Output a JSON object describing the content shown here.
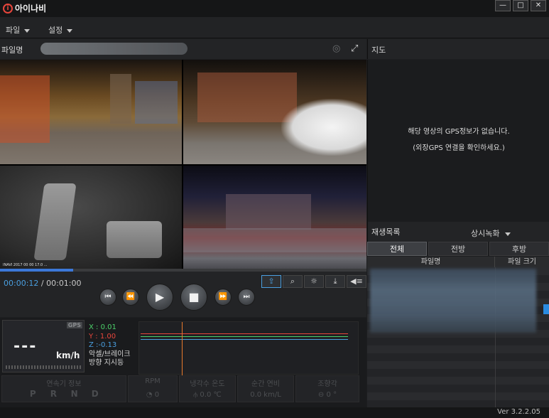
{
  "app": {
    "name": "아이나비",
    "logo_mark": "i"
  },
  "window_controls": {
    "minimize": "—",
    "maximize": "□",
    "close": "✕"
  },
  "menu": [
    {
      "label": "파일"
    },
    {
      "label": "설정"
    }
  ],
  "file": {
    "label": "파일명",
    "icons": [
      "camera-icon",
      "fullscreen-icon"
    ]
  },
  "cam1_overlay": "INAVI 2017 00 00 17.0 ...",
  "playback": {
    "current_time": "00:00:12",
    "total_time": "00:01:00",
    "progress": 0.2,
    "tools": [
      "share-icon",
      "search-icon",
      "brightness-icon",
      "download-icon",
      "volume-icon"
    ],
    "buttons": [
      "previous-file",
      "rewind",
      "play",
      "stop",
      "fast-forward",
      "next-file"
    ]
  },
  "speed": {
    "gps_tag": "GPS",
    "value": "---",
    "unit": "km/h"
  },
  "gsensor": {
    "x": "X : 0.01",
    "y": "Y : 1.00",
    "z": "Z :-0.13",
    "label1": "악셀/브레이크",
    "label2": "방향 지시등"
  },
  "obd": {
    "vehicle_info": {
      "label": "연속기 정보",
      "gears": [
        "P",
        "R",
        "N",
        "D"
      ]
    },
    "rpm": {
      "label": "RPM",
      "value": "0"
    },
    "coolant": {
      "label": "냉각수 온도",
      "value": "0.0",
      "unit": "℃"
    },
    "fuel": {
      "label": "순간 연비",
      "value": "0.0",
      "unit": "km/L"
    },
    "throttle": {
      "label": "조향각",
      "value": "0",
      "unit": "°"
    }
  },
  "map": {
    "title": "지도",
    "message1": "해당 영상의 GPS정보가 없습니다.",
    "message2": "(외장GPS 연결을 확인하세요.)"
  },
  "playlist": {
    "title": "재생목록",
    "mode": "상시녹화",
    "tabs": [
      {
        "label": "전체",
        "active": true
      },
      {
        "label": "전방",
        "active": false
      },
      {
        "label": "후방",
        "active": false
      }
    ],
    "columns": [
      "파일명",
      "파일 크기"
    ]
  },
  "version": "Ver 3.2.2.05",
  "colors": {
    "accent": "#4a9fe0",
    "logo": "#e8463c",
    "gsensor_x": "#4cd06a",
    "gsensor_y": "#e8463c",
    "gsensor_z": "#4a9fe0",
    "cursor": "#e87a2c"
  }
}
